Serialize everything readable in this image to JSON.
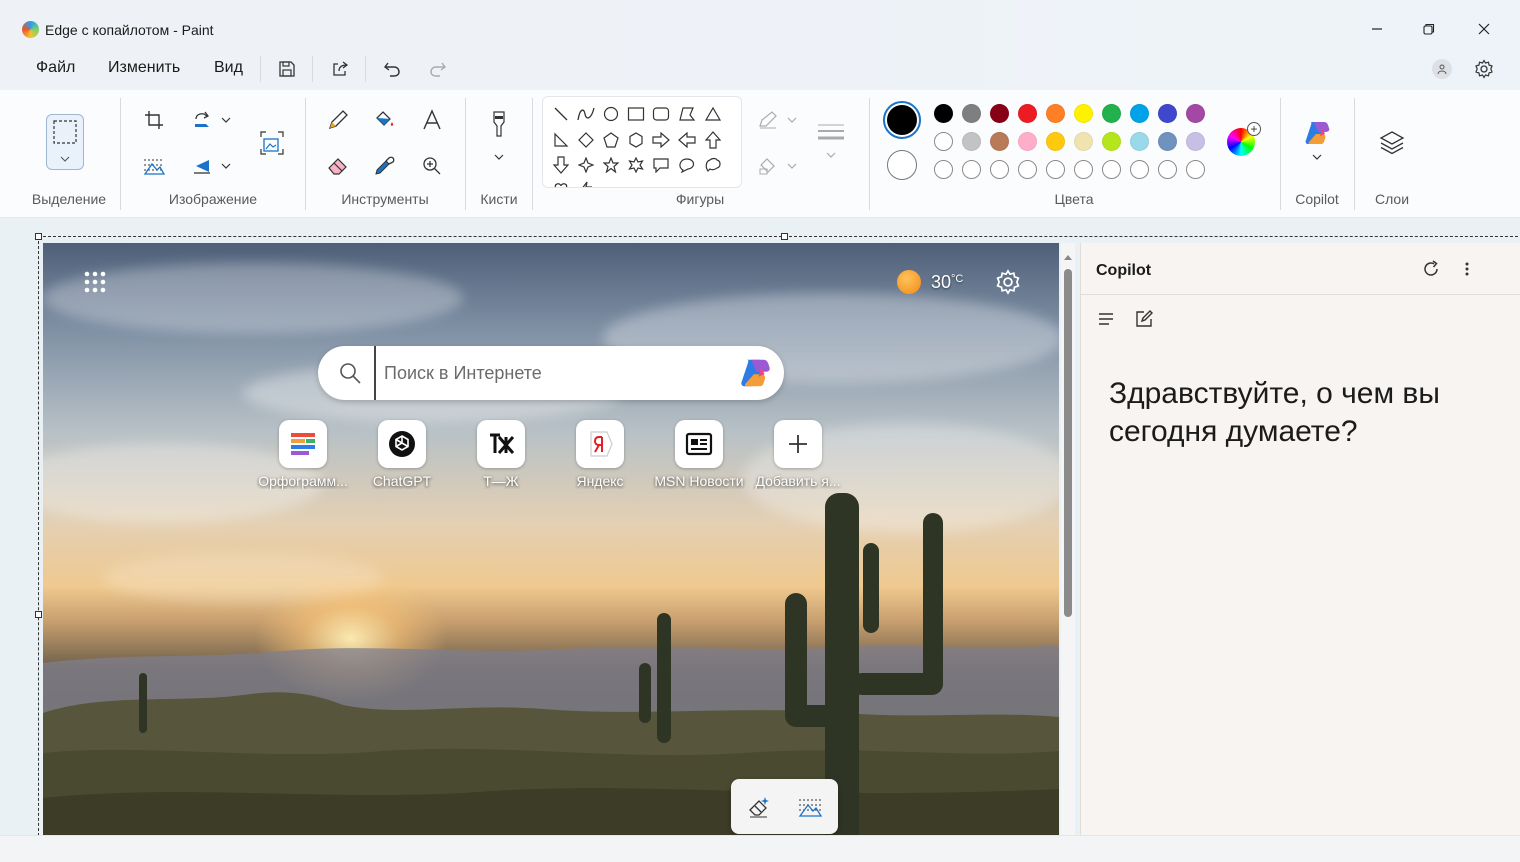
{
  "window": {
    "title": "Edge с копайлотом - Paint"
  },
  "menu": {
    "file": "Файл",
    "edit": "Изменить",
    "view": "Вид"
  },
  "ribbon": {
    "groups": {
      "selection": "Выделение",
      "image": "Изображение",
      "tools": "Инструменты",
      "brushes": "Кисти",
      "shapes": "Фигуры",
      "colors": "Цвета",
      "copilot": "Copilot",
      "layers": "Слои"
    },
    "colors": {
      "primary": "#000000",
      "secondary": "#ffffff",
      "row1": [
        "#000000",
        "#7f7f7f",
        "#880015",
        "#ed1c24",
        "#ff7f27",
        "#fff200",
        "#22b14c",
        "#00a2e8",
        "#3f48cc",
        "#a349a4"
      ],
      "row2": [
        "#ffffff",
        "#c3c3c3",
        "#b97a57",
        "#ffaec9",
        "#ffc90e",
        "#efe4b0",
        "#b5e61d",
        "#99d9ea",
        "#7092be",
        "#c8bfe7"
      ]
    }
  },
  "browser": {
    "weather": "30",
    "weather_unit": "°C",
    "search_placeholder": "Поиск в Интернете",
    "tiles": [
      {
        "label": "Орфограмм...",
        "icon": "orfogrammka-icon"
      },
      {
        "label": "ChatGPT",
        "icon": "chatgpt-icon"
      },
      {
        "label": "Т—Ж",
        "icon": "tj-icon"
      },
      {
        "label": "Яндекс",
        "icon": "yandex-icon"
      },
      {
        "label": "MSN Новости",
        "icon": "msn-news-icon"
      },
      {
        "label": "Добавить я...",
        "icon": "add-icon"
      }
    ]
  },
  "copilot_panel": {
    "title": "Copilot",
    "greeting": "Здравствуйте, о чем вы сегодня думаете?"
  }
}
